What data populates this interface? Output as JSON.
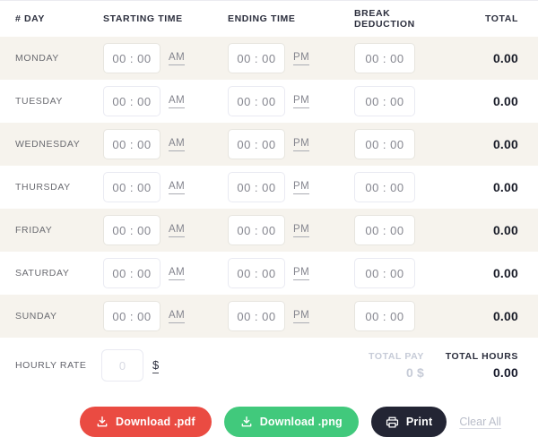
{
  "colors": {
    "accent_red": "#ea4b42",
    "accent_green": "#41c97c",
    "accent_dark": "#232534",
    "row_alt_bg": "#f6f3ed"
  },
  "table": {
    "headers": [
      "# DAY",
      "STARTING TIME",
      "ENDING TIME",
      "BREAK DEDUCTION",
      "TOTAL"
    ],
    "rows": [
      {
        "day": "MONDAY",
        "start": "00 : 00",
        "start_meridiem": "AM",
        "end": "00 : 00",
        "end_meridiem": "PM",
        "break": "00 : 00",
        "total": "0.00"
      },
      {
        "day": "TUESDAY",
        "start": "00 : 00",
        "start_meridiem": "AM",
        "end": "00 : 00",
        "end_meridiem": "PM",
        "break": "00 : 00",
        "total": "0.00"
      },
      {
        "day": "WEDNESDAY",
        "start": "00 : 00",
        "start_meridiem": "AM",
        "end": "00 : 00",
        "end_meridiem": "PM",
        "break": "00 : 00",
        "total": "0.00"
      },
      {
        "day": "THURSDAY",
        "start": "00 : 00",
        "start_meridiem": "AM",
        "end": "00 : 00",
        "end_meridiem": "PM",
        "break": "00 : 00",
        "total": "0.00"
      },
      {
        "day": "FRIDAY",
        "start": "00 : 00",
        "start_meridiem": "AM",
        "end": "00 : 00",
        "end_meridiem": "PM",
        "break": "00 : 00",
        "total": "0.00"
      },
      {
        "day": "SATURDAY",
        "start": "00 : 00",
        "start_meridiem": "AM",
        "end": "00 : 00",
        "end_meridiem": "PM",
        "break": "00 : 00",
        "total": "0.00"
      },
      {
        "day": "SUNDAY",
        "start": "00 : 00",
        "start_meridiem": "AM",
        "end": "00 : 00",
        "end_meridiem": "PM",
        "break": "00 : 00",
        "total": "0.00"
      }
    ]
  },
  "footer": {
    "hourly_rate_label": "HOURLY RATE",
    "hourly_rate_placeholder": "0",
    "currency_symbol": "$",
    "total_pay_label": "TOTAL PAY",
    "total_pay_value": "0 $",
    "total_hours_label": "TOTAL HOURS",
    "total_hours_value": "0.00"
  },
  "actions": {
    "download_pdf_label": "Download .pdf",
    "download_png_label": "Download .png",
    "print_label": "Print",
    "clear_all_label": "Clear All"
  }
}
